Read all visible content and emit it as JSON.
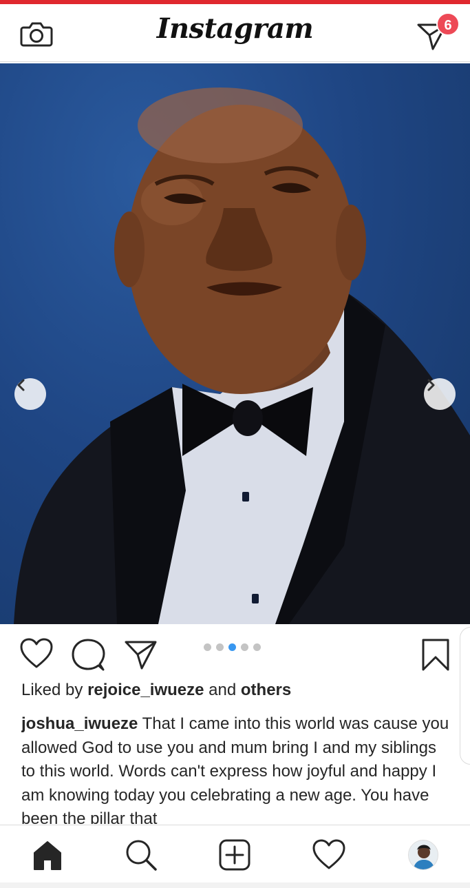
{
  "app": {
    "logo_text": "Instagram",
    "direct_badge_count": "6"
  },
  "post": {
    "carousel": {
      "total_slides": 5,
      "active_slide": 3
    },
    "liked_by": {
      "prefix": "Liked by",
      "user": "rejoice_iwueze",
      "conjunction": "and",
      "others": "others"
    },
    "caption": {
      "username": "joshua_iwueze",
      "text": "That I came into this world was cause you allowed God to use you and mum bring I and my siblings to this world. Words can't express how joyful and happy I am knowing today you celebrating a new age. You have been the pillar that"
    }
  },
  "icons": {
    "camera": "camera-icon",
    "direct": "paper-plane-icon",
    "like": "heart-icon",
    "comment": "comment-bubble-icon",
    "share": "paper-plane-icon",
    "save": "bookmark-icon",
    "prev": "chevron-left-icon",
    "next": "chevron-right-icon",
    "home": "home-icon",
    "search": "search-icon",
    "new_post": "plus-square-icon",
    "activity": "heart-icon",
    "profile": "avatar"
  },
  "colors": {
    "accent_strip": "#e0282e",
    "badge": "#ed4956",
    "active_dot": "#3897f0",
    "text": "#262626"
  }
}
